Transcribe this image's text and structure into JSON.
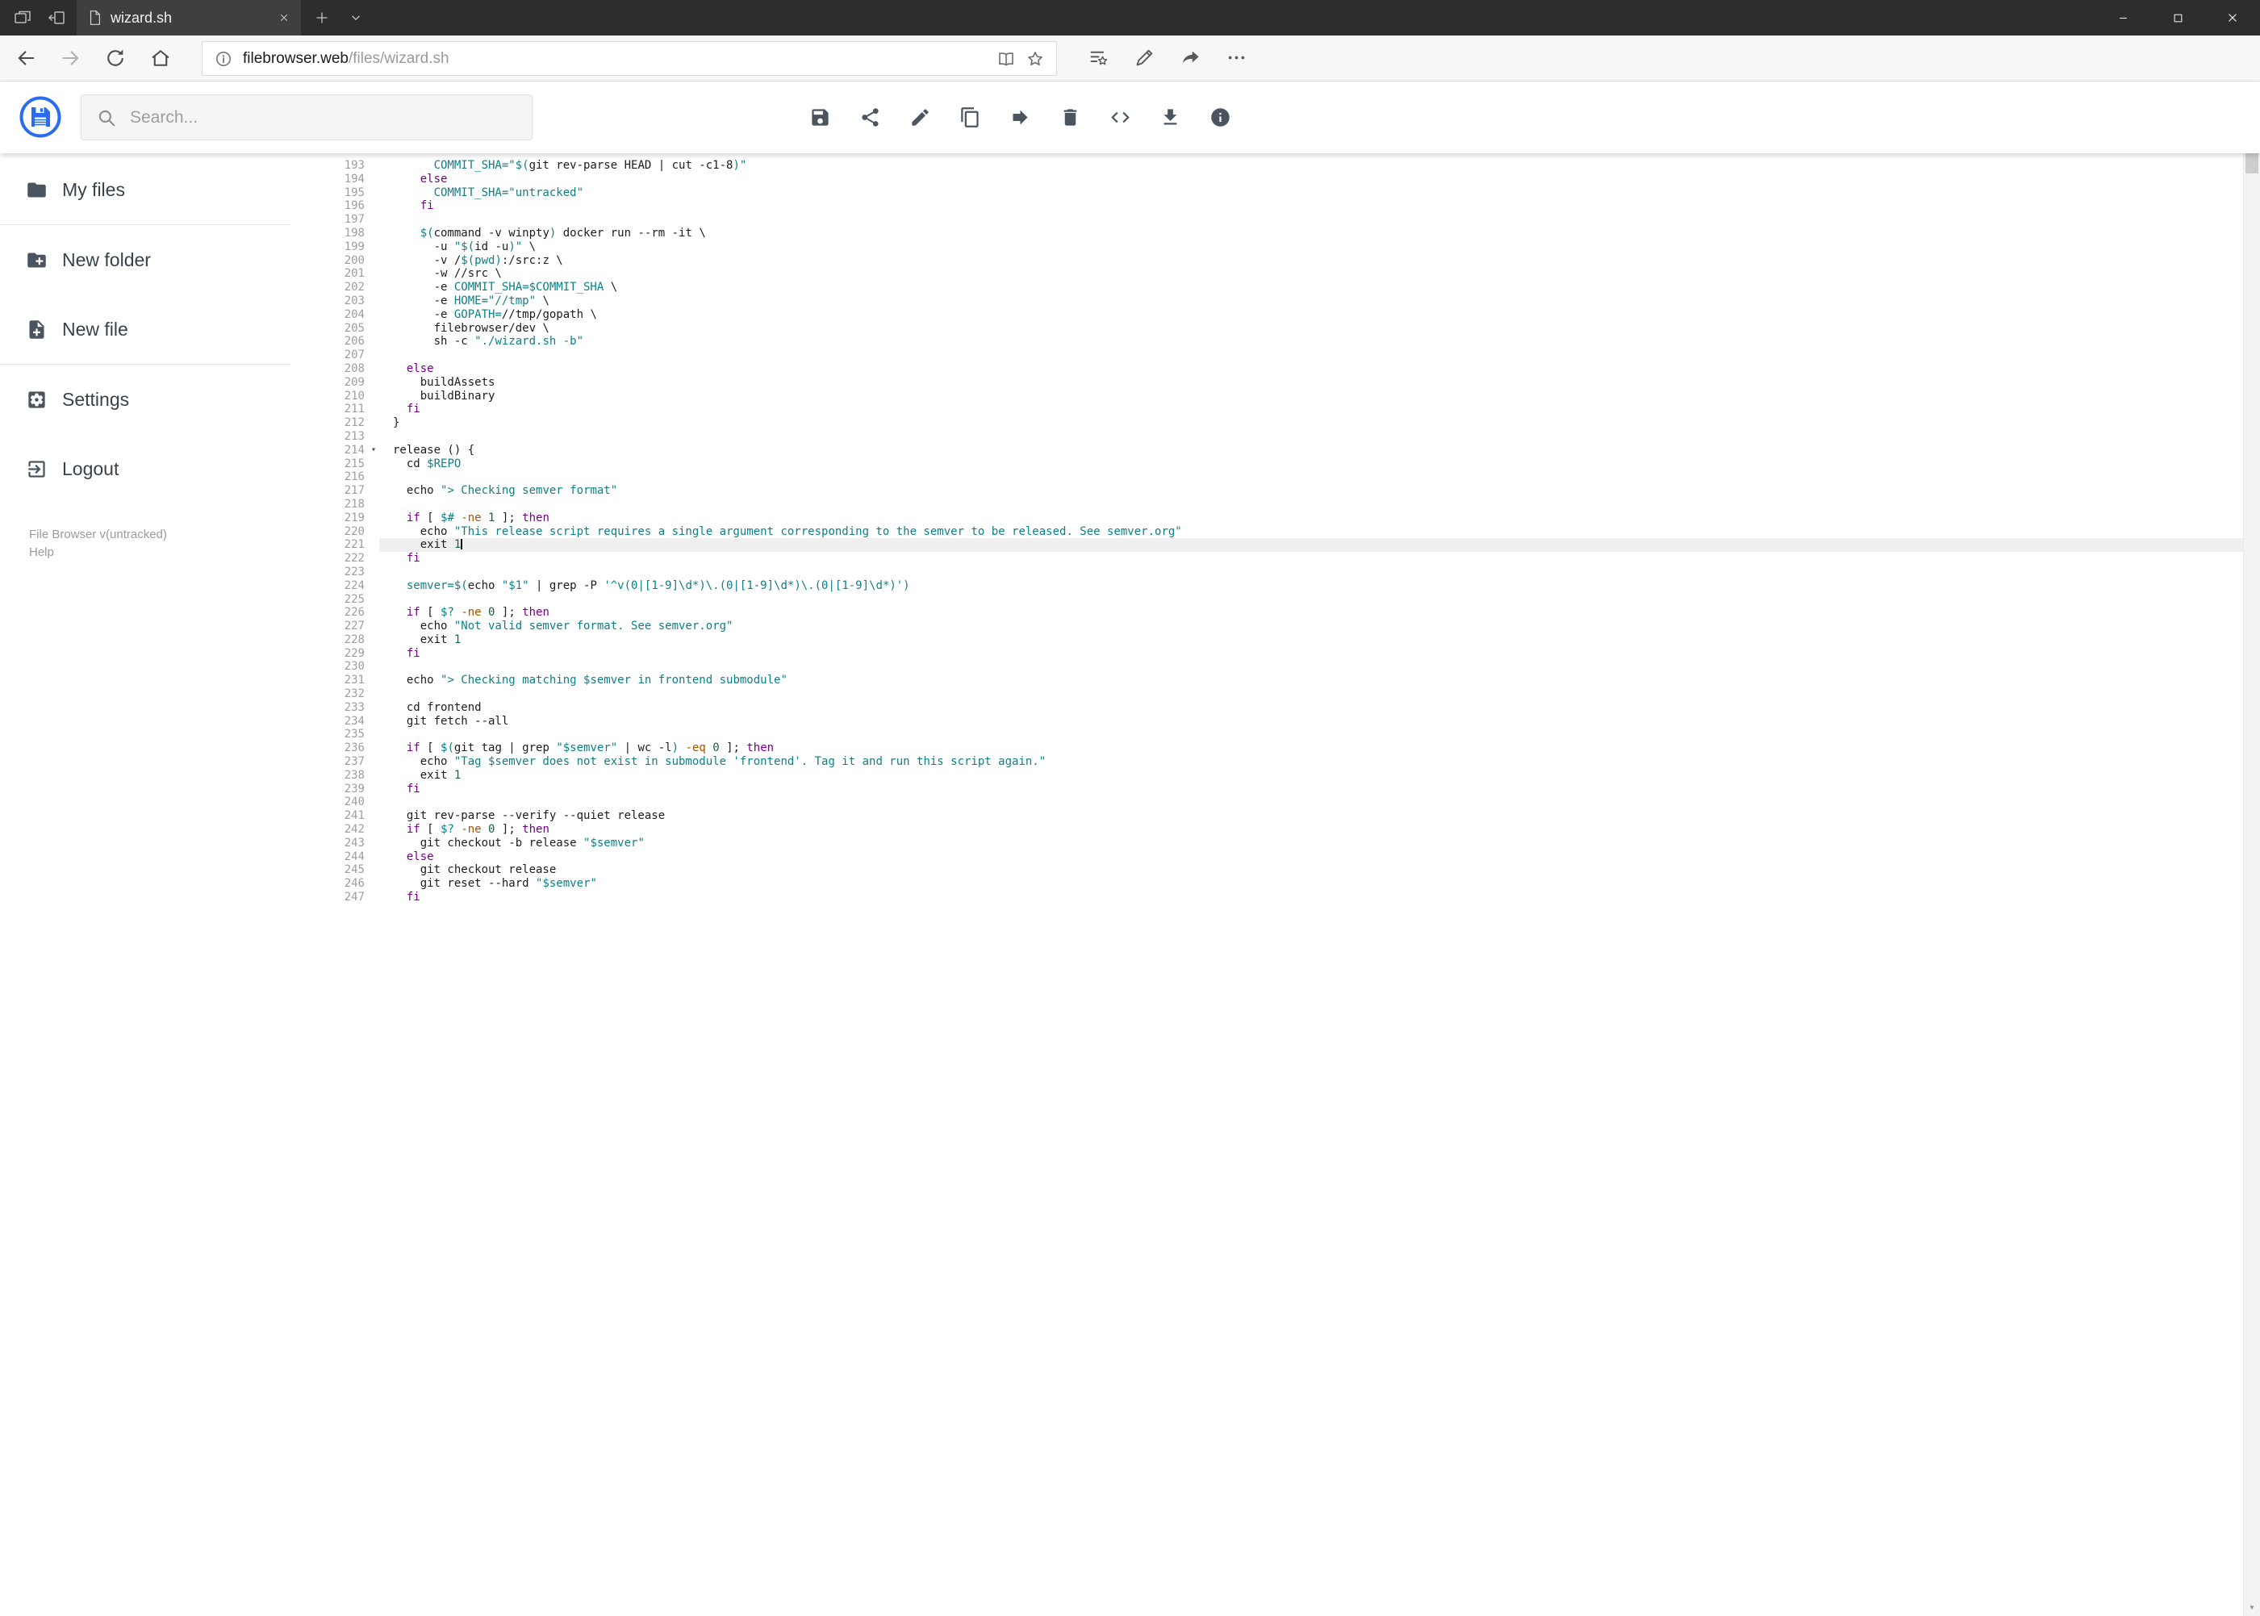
{
  "browser": {
    "tab_title": "wizard.sh",
    "url": {
      "domain": "filebrowser.web",
      "path": "/files/wizard.sh"
    },
    "window_controls": [
      "minimize",
      "maximize",
      "close"
    ]
  },
  "app_header": {
    "search_placeholder": "Search...",
    "toolbar_icons": [
      "save",
      "share",
      "edit",
      "copy",
      "move",
      "delete",
      "code",
      "download",
      "info"
    ]
  },
  "sidebar": {
    "items": [
      {
        "label": "My files",
        "icon": "folder"
      },
      {
        "label": "New folder",
        "icon": "new-folder"
      },
      {
        "label": "New file",
        "icon": "new-file"
      },
      {
        "label": "Settings",
        "icon": "settings"
      },
      {
        "label": "Logout",
        "icon": "logout"
      }
    ],
    "footer": {
      "version": "File Browser v(untracked)",
      "help": "Help"
    }
  },
  "colors": {
    "accent_blue": "#2a6cf0",
    "tabbar_bg": "#2d2d2d",
    "icon_gray": "#4a5560",
    "string_teal": "#0e7f86",
    "keyword_purple": "#770088"
  },
  "editor": {
    "active_line": 221,
    "token_colors": {
      "plain": "#1c1c1c",
      "keyword": "#770088",
      "string": "#0e7f86",
      "number": "#116644",
      "option": "#a85000"
    },
    "lines": [
      {
        "n": 193,
        "seg": [
          [
            "s",
            "      COMMIT_SHA=\"$("
          ],
          [
            "p",
            "git rev-parse HEAD | cut -c1-8"
          ],
          [
            "s",
            ")\""
          ]
        ]
      },
      {
        "n": 194,
        "seg": [
          [
            "p",
            "    "
          ],
          [
            "k",
            "else"
          ]
        ]
      },
      {
        "n": 195,
        "seg": [
          [
            "s",
            "      COMMIT_SHA=\"untracked\""
          ]
        ]
      },
      {
        "n": 196,
        "seg": [
          [
            "p",
            "    "
          ],
          [
            "k",
            "fi"
          ]
        ]
      },
      {
        "n": 197,
        "seg": []
      },
      {
        "n": 198,
        "seg": [
          [
            "p",
            "    "
          ],
          [
            "s",
            "$("
          ],
          [
            "p",
            "command -v winpty"
          ],
          [
            "s",
            ")"
          ],
          [
            "p",
            " docker run --rm -it \\"
          ]
        ]
      },
      {
        "n": 199,
        "seg": [
          [
            "p",
            "      -u "
          ],
          [
            "s",
            "\"$("
          ],
          [
            "p",
            "id -u"
          ],
          [
            "s",
            ")\""
          ],
          [
            "p",
            " \\"
          ]
        ]
      },
      {
        "n": 200,
        "seg": [
          [
            "p",
            "      -v /"
          ],
          [
            "s",
            "$(pwd)"
          ],
          [
            "p",
            ":/src:z \\"
          ]
        ]
      },
      {
        "n": 201,
        "seg": [
          [
            "p",
            "      -w //src \\"
          ]
        ]
      },
      {
        "n": 202,
        "seg": [
          [
            "p",
            "      -e "
          ],
          [
            "s",
            "COMMIT_SHA=$COMMIT_SHA"
          ],
          [
            "p",
            " \\"
          ]
        ]
      },
      {
        "n": 203,
        "seg": [
          [
            "p",
            "      -e "
          ],
          [
            "s",
            "HOME=\"//tmp\""
          ],
          [
            "p",
            " \\"
          ]
        ]
      },
      {
        "n": 204,
        "seg": [
          [
            "p",
            "      -e "
          ],
          [
            "s",
            "GOPATH="
          ],
          [
            "p",
            "//tmp/gopath \\"
          ]
        ]
      },
      {
        "n": 205,
        "seg": [
          [
            "p",
            "      filebrowser/dev \\"
          ]
        ]
      },
      {
        "n": 206,
        "seg": [
          [
            "p",
            "      sh -c "
          ],
          [
            "s",
            "\"./wizard.sh -b\""
          ]
        ]
      },
      {
        "n": 207,
        "seg": []
      },
      {
        "n": 208,
        "seg": [
          [
            "p",
            "  "
          ],
          [
            "k",
            "else"
          ]
        ]
      },
      {
        "n": 209,
        "seg": [
          [
            "p",
            "    buildAssets"
          ]
        ]
      },
      {
        "n": 210,
        "seg": [
          [
            "p",
            "    buildBinary"
          ]
        ]
      },
      {
        "n": 211,
        "seg": [
          [
            "p",
            "  "
          ],
          [
            "k",
            "fi"
          ]
        ]
      },
      {
        "n": 212,
        "seg": [
          [
            "p",
            "}"
          ]
        ]
      },
      {
        "n": 213,
        "seg": []
      },
      {
        "n": 214,
        "fold": true,
        "seg": [
          [
            "p",
            "release () {"
          ]
        ]
      },
      {
        "n": 215,
        "seg": [
          [
            "p",
            "  cd "
          ],
          [
            "s",
            "$REPO"
          ]
        ]
      },
      {
        "n": 216,
        "seg": []
      },
      {
        "n": 217,
        "seg": [
          [
            "p",
            "  echo "
          ],
          [
            "s",
            "\"> Checking semver format\""
          ]
        ]
      },
      {
        "n": 218,
        "seg": []
      },
      {
        "n": 219,
        "seg": [
          [
            "p",
            "  "
          ],
          [
            "k",
            "if"
          ],
          [
            "p",
            " [ "
          ],
          [
            "s",
            "$#"
          ],
          [
            "p",
            " "
          ],
          [
            "o",
            "-ne"
          ],
          [
            "p",
            " "
          ],
          [
            "n",
            "1"
          ],
          [
            "p",
            " ]; "
          ],
          [
            "k",
            "then"
          ]
        ]
      },
      {
        "n": 220,
        "seg": [
          [
            "p",
            "    echo "
          ],
          [
            "s",
            "\"This release script requires a single argument corresponding to the semver to be released. See semver.org\""
          ]
        ]
      },
      {
        "n": 221,
        "active": true,
        "caret": true,
        "seg": [
          [
            "p",
            "    exit "
          ],
          [
            "n",
            "1"
          ]
        ]
      },
      {
        "n": 222,
        "seg": [
          [
            "p",
            "  "
          ],
          [
            "k",
            "fi"
          ]
        ]
      },
      {
        "n": 223,
        "seg": []
      },
      {
        "n": 224,
        "seg": [
          [
            "s",
            "  semver=$("
          ],
          [
            "p",
            "echo "
          ],
          [
            "s",
            "\"$1\""
          ],
          [
            "p",
            " | grep -P "
          ],
          [
            "s",
            "'^v(0|[1-9]\\d*)\\.(0|[1-9]\\d*)\\.(0|[1-9]\\d*)')"
          ]
        ]
      },
      {
        "n": 225,
        "seg": []
      },
      {
        "n": 226,
        "seg": [
          [
            "p",
            "  "
          ],
          [
            "k",
            "if"
          ],
          [
            "p",
            " [ "
          ],
          [
            "s",
            "$?"
          ],
          [
            "p",
            " "
          ],
          [
            "o",
            "-ne"
          ],
          [
            "p",
            " "
          ],
          [
            "n",
            "0"
          ],
          [
            "p",
            " ]; "
          ],
          [
            "k",
            "then"
          ]
        ]
      },
      {
        "n": 227,
        "seg": [
          [
            "p",
            "    echo "
          ],
          [
            "s",
            "\"Not valid semver format. See semver.org\""
          ]
        ]
      },
      {
        "n": 228,
        "seg": [
          [
            "p",
            "    exit "
          ],
          [
            "n",
            "1"
          ]
        ]
      },
      {
        "n": 229,
        "seg": [
          [
            "p",
            "  "
          ],
          [
            "k",
            "fi"
          ]
        ]
      },
      {
        "n": 230,
        "seg": []
      },
      {
        "n": 231,
        "seg": [
          [
            "p",
            "  echo "
          ],
          [
            "s",
            "\"> Checking matching $semver in frontend submodule\""
          ]
        ]
      },
      {
        "n": 232,
        "seg": []
      },
      {
        "n": 233,
        "seg": [
          [
            "p",
            "  cd frontend"
          ]
        ]
      },
      {
        "n": 234,
        "seg": [
          [
            "p",
            "  git fetch --all"
          ]
        ]
      },
      {
        "n": 235,
        "seg": []
      },
      {
        "n": 236,
        "seg": [
          [
            "p",
            "  "
          ],
          [
            "k",
            "if"
          ],
          [
            "p",
            " [ "
          ],
          [
            "s",
            "$("
          ],
          [
            "p",
            "git tag | grep "
          ],
          [
            "s",
            "\"$semver\""
          ],
          [
            "p",
            " | wc -l"
          ],
          [
            "s",
            ")"
          ],
          [
            "p",
            " "
          ],
          [
            "o",
            "-eq"
          ],
          [
            "p",
            " "
          ],
          [
            "n",
            "0"
          ],
          [
            "p",
            " ]; "
          ],
          [
            "k",
            "then"
          ]
        ]
      },
      {
        "n": 237,
        "seg": [
          [
            "p",
            "    echo "
          ],
          [
            "s",
            "\"Tag $semver does not exist in submodule 'frontend'. Tag it and run this script again.\""
          ]
        ]
      },
      {
        "n": 238,
        "seg": [
          [
            "p",
            "    exit "
          ],
          [
            "n",
            "1"
          ]
        ]
      },
      {
        "n": 239,
        "seg": [
          [
            "p",
            "  "
          ],
          [
            "k",
            "fi"
          ]
        ]
      },
      {
        "n": 240,
        "seg": []
      },
      {
        "n": 241,
        "seg": [
          [
            "p",
            "  git rev-parse --verify --quiet release"
          ]
        ]
      },
      {
        "n": 242,
        "seg": [
          [
            "p",
            "  "
          ],
          [
            "k",
            "if"
          ],
          [
            "p",
            " [ "
          ],
          [
            "s",
            "$?"
          ],
          [
            "p",
            " "
          ],
          [
            "o",
            "-ne"
          ],
          [
            "p",
            " "
          ],
          [
            "n",
            "0"
          ],
          [
            "p",
            " ]; "
          ],
          [
            "k",
            "then"
          ]
        ]
      },
      {
        "n": 243,
        "seg": [
          [
            "p",
            "    git checkout -b release "
          ],
          [
            "s",
            "\"$semver\""
          ]
        ]
      },
      {
        "n": 244,
        "seg": [
          [
            "p",
            "  "
          ],
          [
            "k",
            "else"
          ]
        ]
      },
      {
        "n": 245,
        "seg": [
          [
            "p",
            "    git checkout release"
          ]
        ]
      },
      {
        "n": 246,
        "seg": [
          [
            "p",
            "    git reset --hard "
          ],
          [
            "s",
            "\"$semver\""
          ]
        ]
      },
      {
        "n": 247,
        "seg": [
          [
            "p",
            "  "
          ],
          [
            "k",
            "fi"
          ]
        ]
      }
    ]
  }
}
